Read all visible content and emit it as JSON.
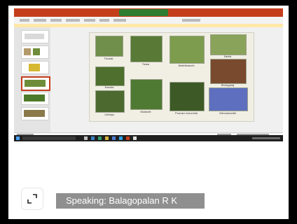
{
  "plants": [
    {
      "name": "Thulasi"
    },
    {
      "name": "Tulasi"
    },
    {
      "name": "Mukhthanchi"
    },
    {
      "name": "Neela"
    },
    {
      "name": "Karuka"
    },
    {
      "name": "Bhringaraj"
    },
    {
      "name": "Mukkutti"
    },
    {
      "name": "Poovam kurunnila"
    },
    {
      "name": "Vishnukranthi"
    },
    {
      "name": "Uzhinja"
    }
  ],
  "speaker": {
    "label": "Speaking: Balagopalan R K"
  },
  "colors": {
    "titlebar": "#c43e1c",
    "taskbar": "#1f1f1f",
    "speaking_bg": "#8f8f8f"
  },
  "icons": {
    "expand": "expand-icon"
  }
}
